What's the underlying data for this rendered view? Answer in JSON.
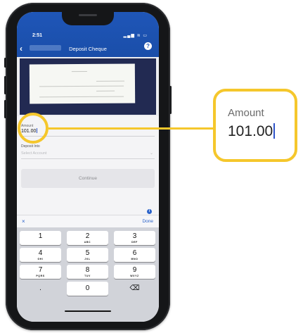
{
  "status_bar": {
    "time": "2:51",
    "icons": "▂▄▆ ≋ ▭"
  },
  "header": {
    "title": "Deposit Cheque",
    "back_icon": "‹",
    "help_icon": "?"
  },
  "form": {
    "amount_label": "Amount",
    "amount_value": "101.00",
    "deposit_into_label": "Deposit Into",
    "select_account_placeholder": "Select Account",
    "chevron": "⌄",
    "continue_label": "Continue",
    "info_icon": "i"
  },
  "keyboard": {
    "close_label": "×",
    "done_label": "Done",
    "keys": [
      {
        "num": "1",
        "letters": ""
      },
      {
        "num": "2",
        "letters": "ABC"
      },
      {
        "num": "3",
        "letters": "DEF"
      },
      {
        "num": "4",
        "letters": "GHI"
      },
      {
        "num": "5",
        "letters": "JKL"
      },
      {
        "num": "6",
        "letters": "MNO"
      },
      {
        "num": "7",
        "letters": "PQRS"
      },
      {
        "num": "8",
        "letters": "TUV"
      },
      {
        "num": "9",
        "letters": "WXYZ"
      },
      {
        "num": ".",
        "letters": ""
      },
      {
        "num": "0",
        "letters": ""
      },
      {
        "num": "⌫",
        "letters": ""
      }
    ]
  },
  "callout": {
    "label": "Amount",
    "value": "101.00"
  },
  "colors": {
    "brand_blue": "#1f56b8",
    "highlight_yellow": "#f5c72c"
  }
}
